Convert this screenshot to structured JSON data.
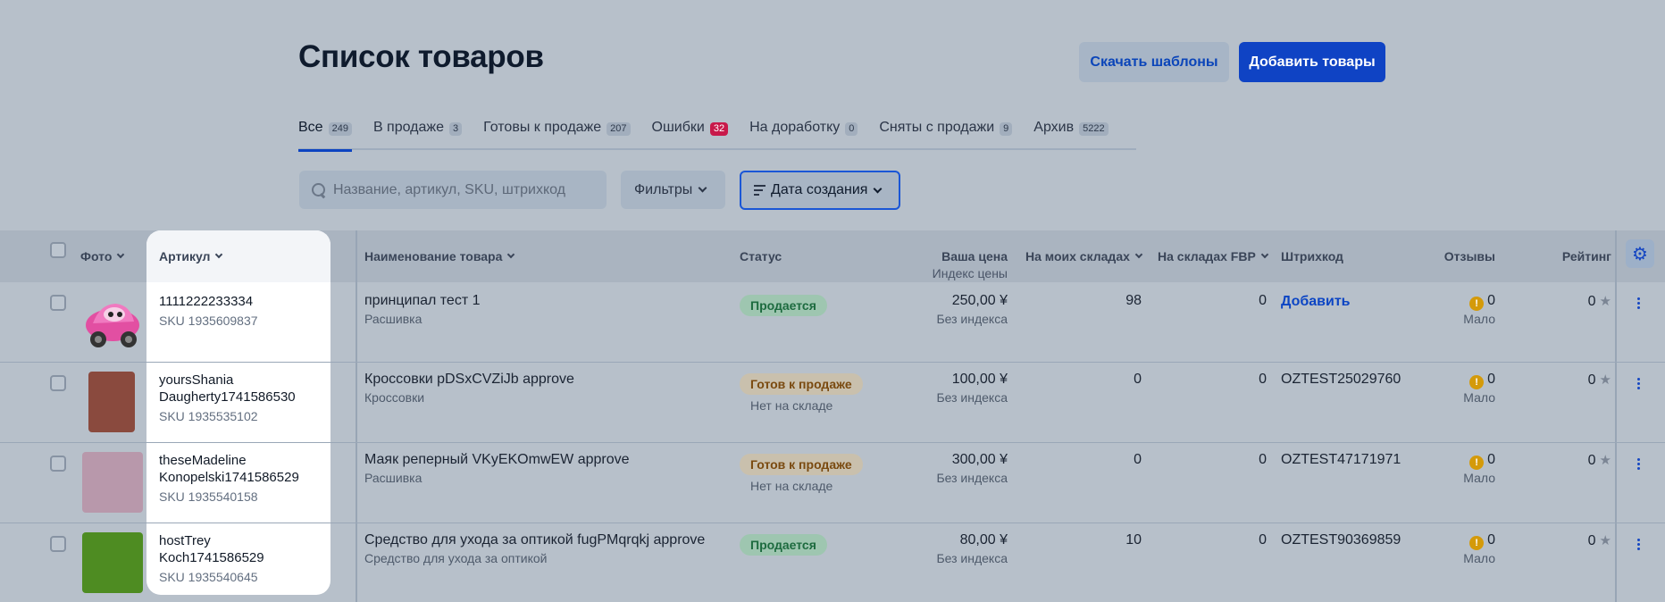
{
  "header": {
    "title": "Список товаров",
    "download_templates": "Скачать шаблоны",
    "add_products": "Добавить товары"
  },
  "tabs": [
    {
      "label": "Все",
      "count": "249"
    },
    {
      "label": "В продаже",
      "count": "3"
    },
    {
      "label": "Готовы к продаже",
      "count": "207"
    },
    {
      "label": "Ошибки",
      "count": "32"
    },
    {
      "label": "На доработку",
      "count": "0"
    },
    {
      "label": "Сняты с продажи",
      "count": "9"
    },
    {
      "label": "Архив",
      "count": "5222"
    }
  ],
  "toolbar": {
    "search_placeholder": "Название, артикул, SKU, штрихкод",
    "filters_label": "Фильтры",
    "sort_label": "Дата создания"
  },
  "columns": {
    "photo": "Фото",
    "article": "Артикул",
    "name": "Наименование товара",
    "status": "Статус",
    "price": "Ваша цена",
    "price_sub": "Индекс цены",
    "own_stock": "На моих складах",
    "fbp_stock": "На складах FBP",
    "barcode": "Штрихкод",
    "reviews": "Отзывы",
    "rating": "Рейтинг"
  },
  "colors": {
    "accent": "#0f43c4",
    "error_badge": "#c8194a",
    "thumb_1": "#e24fa2",
    "thumb_2": "#8a4a3e",
    "thumb_3": "#b898ab",
    "thumb_4": "#4e8c22"
  },
  "rows": [
    {
      "article_1": "1111222233334",
      "article_2": "",
      "sku": "SKU 1935609837",
      "name": "принципал тест 1",
      "category": "Расшивка",
      "status": "Продается",
      "status_sub": "",
      "price": "250,00 ¥",
      "price_index": "Без индекса",
      "own_stock": "98",
      "fbp_stock": "0",
      "barcode": "Добавить",
      "reviews": "0",
      "reviews_sub": "Мало",
      "rating": "0",
      "thumb_icon": "toy-car-image"
    },
    {
      "article_1": "yoursShania",
      "article_2": "Daugherty1741586530",
      "sku": "SKU 1935535102",
      "name": "Кроссовки pDSxCVZiJb approve",
      "category": "Кроссовки",
      "status": "Готов к продаже",
      "status_sub": "Нет на складе",
      "price": "100,00 ¥",
      "price_index": "Без индекса",
      "own_stock": "0",
      "fbp_stock": "0",
      "barcode": "OZTEST25029760",
      "reviews": "0",
      "reviews_sub": "Мало",
      "rating": "0"
    },
    {
      "article_1": "theseMadeline",
      "article_2": "Konopelski1741586529",
      "sku": "SKU 1935540158",
      "name": "Маяк реперный VKyEKOmwEW approve",
      "category": "Расшивка",
      "status": "Готов к продаже",
      "status_sub": "Нет на складе",
      "price": "300,00 ¥",
      "price_index": "Без индекса",
      "own_stock": "0",
      "fbp_stock": "0",
      "barcode": "OZTEST47171971",
      "reviews": "0",
      "reviews_sub": "Мало",
      "rating": "0"
    },
    {
      "article_1": "hostTrey",
      "article_2": "Koch1741586529",
      "sku": "SKU 1935540645",
      "name": "Средство для ухода за оптикой fugPMqrqkj approve",
      "category": "Средство для ухода за оптикой",
      "status": "Продается",
      "status_sub": "",
      "price": "80,00 ¥",
      "price_index": "Без индекса",
      "own_stock": "10",
      "fbp_stock": "0",
      "barcode": "OZTEST90369859",
      "reviews": "0",
      "reviews_sub": "Мало",
      "rating": "0"
    }
  ]
}
